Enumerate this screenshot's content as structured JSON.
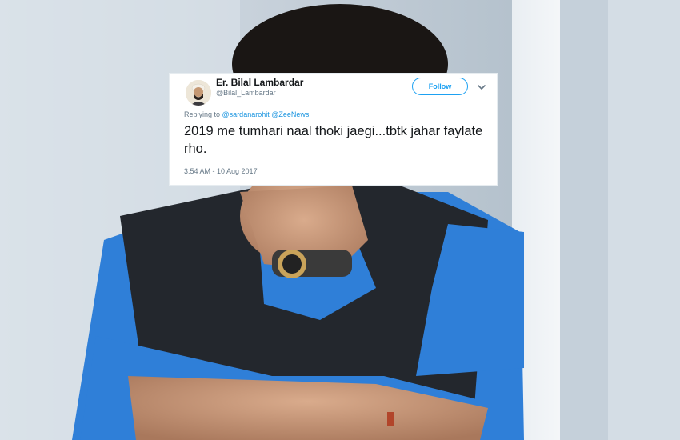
{
  "tweet": {
    "display_name": "Er. Bilal Lambardar",
    "handle": "@Bilal_Lambardar",
    "follow_label": "Follow",
    "reply_prefix": "Replying to",
    "reply_mentions": [
      "@sardanarohit",
      "@ZeeNews"
    ],
    "text": "2019 me tumhari naal thoki jaegi...tbtk jahar faylate rho.",
    "timestamp": "3:54 AM - 10 Aug 2017"
  },
  "icons": {
    "menu": "chevron-down-icon",
    "avatar": "avatar"
  },
  "colors": {
    "accent": "#1da1f2",
    "mention": "#1b95e0",
    "text": "#14171a",
    "muted": "#657786",
    "shirt": "#2f7fd8",
    "vest": "#23272d"
  }
}
